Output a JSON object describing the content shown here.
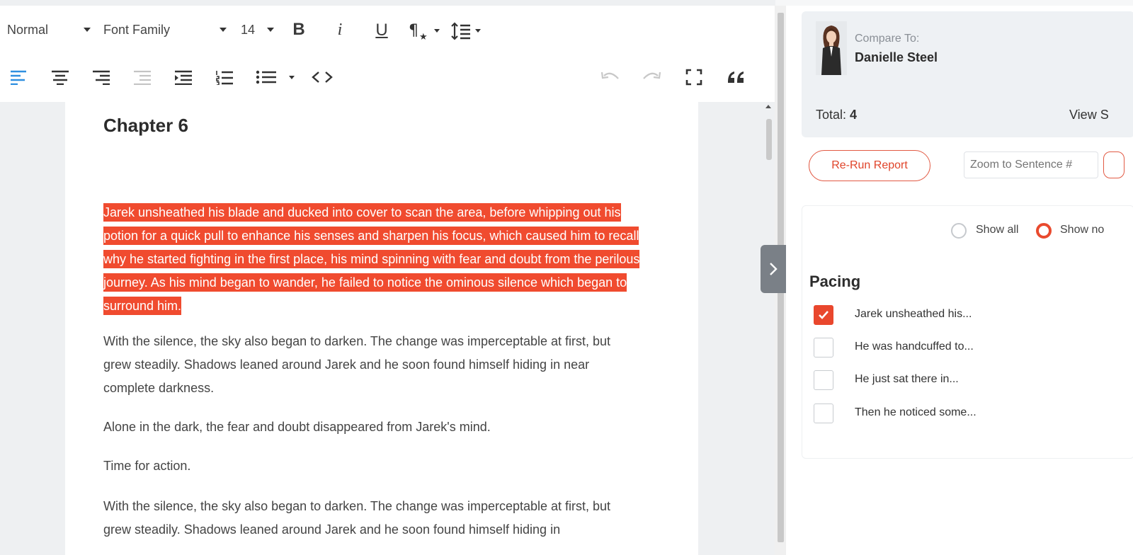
{
  "toolbar": {
    "style_select": "Normal",
    "font_family_select": "Font Family",
    "font_size_select": "14",
    "bold_label": "B",
    "italic_label": "i",
    "underline_label": "U"
  },
  "document": {
    "chapter_title": "Chapter 6",
    "highlighted_paragraph": "Jarek unsheathed his blade and ducked into cover to scan the area, before whipping out his potion for a quick pull to enhance his senses and sharpen his focus, which caused him to recall why he started fighting in the first place, his mind spinning with fear and doubt from the perilous journey. As his mind began to wander, he failed to notice the ominous silence which began to surround him.",
    "paragraphs": [
      "With the silence, the sky also began to darken. The change was imperceptable at first, but grew steadily. Shadows leaned around Jarek and he soon found himself hiding in near complete darkness.",
      "Alone in the dark, the fear and doubt disappeared from Jarek's mind.",
      "Time for action.",
      "With the silence, the sky also began to darken. The change was imperceptable at first, but grew steadily. Shadows leaned around Jarek and he soon found himself hiding in"
    ],
    "highlight_color": "#f04b2f"
  },
  "panel": {
    "compare_label": "Compare To:",
    "compare_name": "Danielle Steel",
    "total_label": "Total:",
    "total_value": "4",
    "view_link": "View S",
    "rerun_button": "Re-Run Report",
    "zoom_placeholder": "Zoom to Sentence #",
    "filter": {
      "show_all": "Show all",
      "show_other": "Show no",
      "selected": "show_other"
    },
    "section_title": "Pacing",
    "items": [
      {
        "label": "Jarek unsheathed his...",
        "checked": true
      },
      {
        "label": "He was handcuffed to...",
        "checked": false
      },
      {
        "label": "He just sat there in...",
        "checked": false
      },
      {
        "label": "Then he noticed some...",
        "checked": false
      }
    ],
    "accent_color": "#e9472d"
  }
}
